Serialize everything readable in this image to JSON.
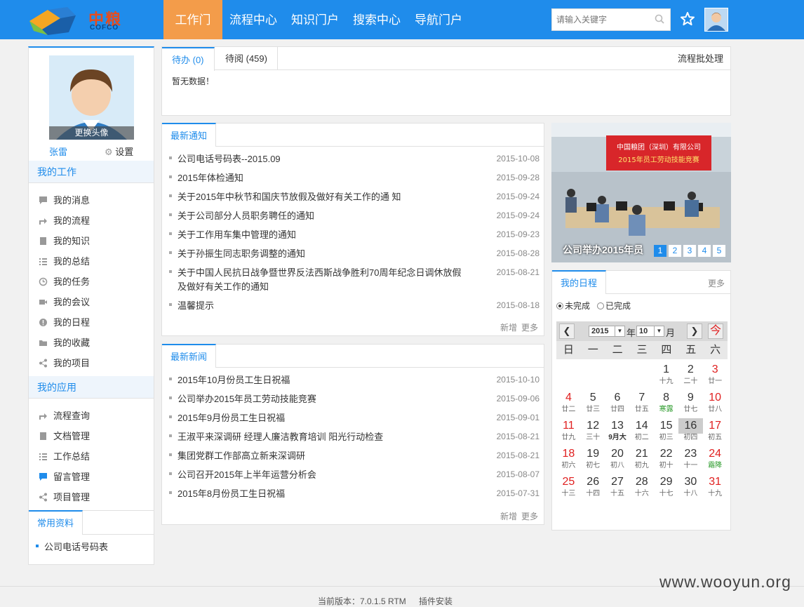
{
  "header": {
    "logo_cn": "中粮",
    "logo_en": "COFCO",
    "nav": [
      "工作门户",
      "流程中心",
      "知识门户",
      "搜索中心",
      "导航门户"
    ],
    "search_placeholder": "请输入关键字"
  },
  "sidebar": {
    "change_avatar": "更换头像",
    "user_name": "张雷",
    "settings": "设置",
    "my_work_title": "我的工作",
    "my_work": [
      "我的消息",
      "我的流程",
      "我的知识",
      "我的总结",
      "我的任务",
      "我的会议",
      "我的日程",
      "我的收藏",
      "我的项目"
    ],
    "my_apps_title": "我的应用",
    "my_apps": [
      "流程查询",
      "文档管理",
      "工作总结",
      "留言管理",
      "项目管理"
    ],
    "common_title": "常用资料",
    "common_items": [
      "公司电话号码表"
    ]
  },
  "todo": {
    "tab_pending": "待办 (0)",
    "tab_read": "待阅 (459)",
    "batch": "流程批处理",
    "empty": "暂无数据！"
  },
  "notices": {
    "title": "最新通知",
    "items": [
      {
        "t": "公司电话号码表--2015.09",
        "d": "2015-10-08"
      },
      {
        "t": "2015年体检通知",
        "d": "2015-09-28"
      },
      {
        "t": "关于2015年中秋节和国庆节放假及做好有关工作的通 知",
        "d": "2015-09-24"
      },
      {
        "t": "关于公司部分人员职务聘任的通知",
        "d": "2015-09-24"
      },
      {
        "t": "关于工作用车集中管理的通知",
        "d": "2015-09-23"
      },
      {
        "t": "关于孙振生同志职务调整的通知",
        "d": "2015-08-28"
      },
      {
        "t": "关于中国人民抗日战争暨世界反法西斯战争胜利70周年纪念日调休放假及做好有关工作的通知",
        "d": "2015-08-21"
      },
      {
        "t": "温馨提示",
        "d": "2015-08-18"
      }
    ],
    "add": "新增",
    "more": "更多"
  },
  "news": {
    "title": "最新新闻",
    "items": [
      {
        "t": "2015年10月份员工生日祝福",
        "d": "2015-10-10"
      },
      {
        "t": "公司举办2015年员工劳动技能竞赛",
        "d": "2015-09-06"
      },
      {
        "t": "2015年9月份员工生日祝福",
        "d": "2015-09-01"
      },
      {
        "t": "王淑平来深调研 经理人廉洁教育培训 阳光行动检查",
        "d": "2015-08-21"
      },
      {
        "t": "集团党群工作部高立新来深调研",
        "d": "2015-08-21"
      },
      {
        "t": "公司召开2015年上半年运营分析会",
        "d": "2015-08-07"
      },
      {
        "t": "2015年8月份员工生日祝福",
        "d": "2015-07-31"
      }
    ],
    "add": "新增",
    "more": "更多"
  },
  "slideshow": {
    "caption": "公司举办2015年员",
    "banner": "中国粮团（深圳）有限公司",
    "banner2": "2015年员工劳动技能竞赛",
    "pages": [
      "1",
      "2",
      "3",
      "4",
      "5"
    ]
  },
  "schedule": {
    "title": "我的日程",
    "more": "更多",
    "unfinished": "未完成",
    "finished": "已完成",
    "year": "2015",
    "year_label": "年",
    "month": "10",
    "month_label": "月",
    "today_btn": "今",
    "weekdays": [
      "日",
      "一",
      "二",
      "三",
      "四",
      "五",
      "六"
    ],
    "days": [
      {
        "d": "",
        "l": ""
      },
      {
        "d": "",
        "l": ""
      },
      {
        "d": "",
        "l": ""
      },
      {
        "d": "",
        "l": ""
      },
      {
        "d": "1",
        "l": "十九"
      },
      {
        "d": "2",
        "l": "二十"
      },
      {
        "d": "3",
        "l": "廿一",
        "r": true
      },
      {
        "d": "4",
        "l": "廿二",
        "r": true
      },
      {
        "d": "5",
        "l": "廿三"
      },
      {
        "d": "6",
        "l": "廿四"
      },
      {
        "d": "7",
        "l": "廿五"
      },
      {
        "d": "8",
        "l": "寒露",
        "h": true
      },
      {
        "d": "9",
        "l": "廿七"
      },
      {
        "d": "10",
        "l": "廿八",
        "r": true
      },
      {
        "d": "11",
        "l": "廿九",
        "r": true
      },
      {
        "d": "12",
        "l": "三十"
      },
      {
        "d": "13",
        "l": "9月大",
        "b": true
      },
      {
        "d": "14",
        "l": "初二"
      },
      {
        "d": "15",
        "l": "初三"
      },
      {
        "d": "16",
        "l": "初四",
        "t": true
      },
      {
        "d": "17",
        "l": "初五",
        "r": true
      },
      {
        "d": "18",
        "l": "初六",
        "r": true
      },
      {
        "d": "19",
        "l": "初七"
      },
      {
        "d": "20",
        "l": "初八"
      },
      {
        "d": "21",
        "l": "初九"
      },
      {
        "d": "22",
        "l": "初十"
      },
      {
        "d": "23",
        "l": "十一"
      },
      {
        "d": "24",
        "l": "霜降",
        "r": true,
        "h": true
      },
      {
        "d": "25",
        "l": "十三",
        "r": true
      },
      {
        "d": "26",
        "l": "十四"
      },
      {
        "d": "27",
        "l": "十五"
      },
      {
        "d": "28",
        "l": "十六"
      },
      {
        "d": "29",
        "l": "十七"
      },
      {
        "d": "30",
        "l": "十八"
      },
      {
        "d": "31",
        "l": "十九",
        "r": true
      }
    ]
  },
  "footer": {
    "version": "当前版本：7.0.1.5 RTM",
    "plugin": "插件安装"
  },
  "watermark": "www.wooyun.org"
}
